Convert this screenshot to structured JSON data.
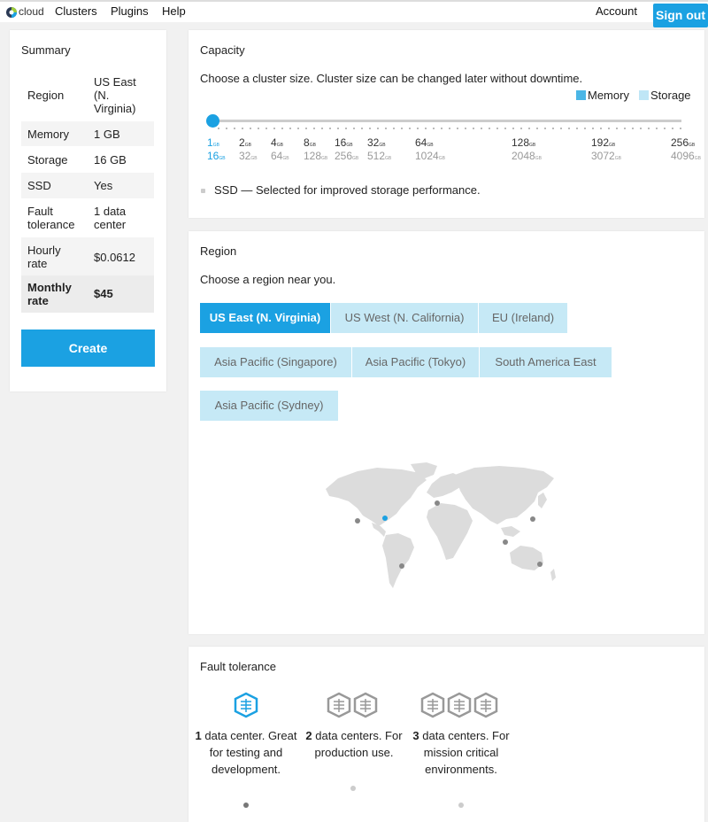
{
  "nav": {
    "logo_text": "cloud",
    "links": [
      "Clusters",
      "Plugins",
      "Help"
    ],
    "account": "Account",
    "signout": "Sign out"
  },
  "summary": {
    "title": "Summary",
    "rows": [
      {
        "key": "Region",
        "value": "US East (N. Virginia)"
      },
      {
        "key": "Memory",
        "value": "1 GB"
      },
      {
        "key": "Storage",
        "value": "16 GB"
      },
      {
        "key": "SSD",
        "value": "Yes"
      },
      {
        "key": "Fault tolerance",
        "value": "1 data center"
      },
      {
        "key": "Hourly rate",
        "value": "$0.0612"
      },
      {
        "key": "Monthly rate",
        "value": "$45"
      }
    ],
    "create_label": "Create"
  },
  "capacity": {
    "title": "Capacity",
    "description": "Choose a cluster size. Cluster size can be changed later without downtime.",
    "legend": {
      "memory": "Memory",
      "storage": "Storage"
    },
    "memory_color": "#4ab6e6",
    "storage_color": "#bfe6f6",
    "selected_index": 0,
    "unit": "GB",
    "sizes": [
      {
        "memory": "1",
        "storage": "16"
      },
      {
        "memory": "2",
        "storage": "32"
      },
      {
        "memory": "4",
        "storage": "64"
      },
      {
        "memory": "8",
        "storage": "128"
      },
      {
        "memory": "16",
        "storage": "256"
      },
      {
        "memory": "32",
        "storage": "512"
      },
      {
        "memory": "64",
        "storage": "1024"
      },
      {
        "memory": "128",
        "storage": "2048"
      },
      {
        "memory": "192",
        "storage": "3072"
      },
      {
        "memory": "256",
        "storage": "4096"
      }
    ],
    "ssd_label": "SSD — Selected for improved storage performance."
  },
  "region": {
    "title": "Region",
    "description": "Choose a region near you.",
    "options": [
      "US East (N. Virginia)",
      "US West (N. California)",
      "EU (Ireland)",
      "Asia Pacific (Singapore)",
      "Asia Pacific (Tokyo)",
      "South America East",
      "Asia Pacific (Sydney)"
    ],
    "selected": "US East (N. Virginia)"
  },
  "fault_tolerance": {
    "title": "Fault tolerance",
    "options": [
      {
        "count": "1",
        "text": "data center. Great for testing and development.",
        "selected": true
      },
      {
        "count": "2",
        "text": "data centers. For production use.",
        "selected": false
      },
      {
        "count": "3",
        "text": "data centers. For mission critical environments.",
        "selected": false
      }
    ]
  },
  "colors": {
    "accent": "#1ba1e2",
    "region_inactive": "#c6e9f6",
    "map": "#dcdcdc"
  }
}
